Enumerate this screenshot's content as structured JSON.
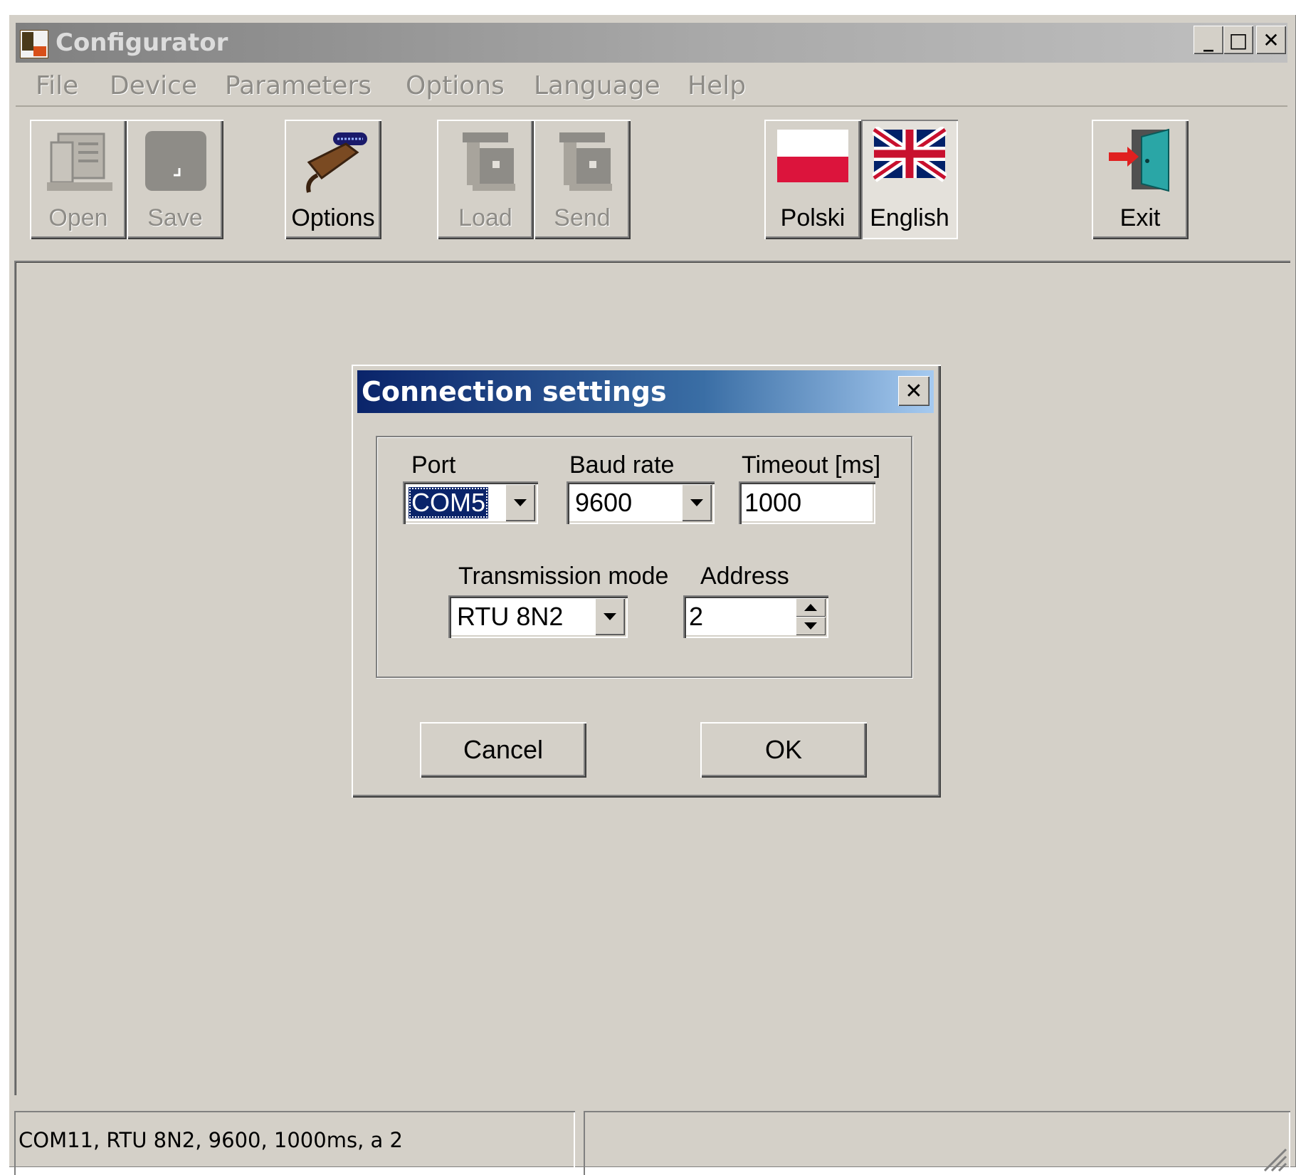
{
  "window": {
    "title": "Configurator",
    "minimize_label": "_",
    "maximize_label": "□",
    "close_label": "✕"
  },
  "menu": {
    "items": [
      {
        "label": "File"
      },
      {
        "label": "Device"
      },
      {
        "label": "Parameters"
      },
      {
        "label": "Options"
      },
      {
        "label": "Language"
      },
      {
        "label": "Help"
      }
    ]
  },
  "toolbar": {
    "open_label": "Open",
    "save_label": "Save",
    "options_label": "Options",
    "load_label": "Load",
    "send_label": "Send",
    "polski_label": "Polski",
    "english_label": "English",
    "exit_label": "Exit",
    "open_icon": "document-icon",
    "save_icon": "floppy-icon",
    "options_icon": "connector-icon",
    "load_icon": "device-icon",
    "send_icon": "device-icon",
    "polski_icon": "polish-flag-icon",
    "english_icon": "uk-flag-icon",
    "exit_icon": "door-exit-icon"
  },
  "dialog": {
    "title": "Connection settings",
    "close_label": "✕",
    "port": {
      "label": "Port",
      "value": "COM5"
    },
    "baud": {
      "label": "Baud rate",
      "value": "9600"
    },
    "timeout": {
      "label": "Timeout [ms]",
      "value": "1000"
    },
    "mode": {
      "label": "Transmission mode",
      "value": "RTU 8N2"
    },
    "address": {
      "label": "Address",
      "value": "2"
    },
    "cancel_label": "Cancel",
    "ok_label": "OK"
  },
  "status": {
    "text": "COM11, RTU 8N2, 9600, 1000ms, a 2",
    "right_text": ""
  },
  "colors": {
    "face": "#d4d0c8",
    "active_caption_start": "#0a246a",
    "active_caption_end": "#a6caf0",
    "inactive_caption": "#808080",
    "disabled_text": "#8e8c87",
    "polish_red": "#dc143c",
    "uk_blue": "#012169"
  }
}
